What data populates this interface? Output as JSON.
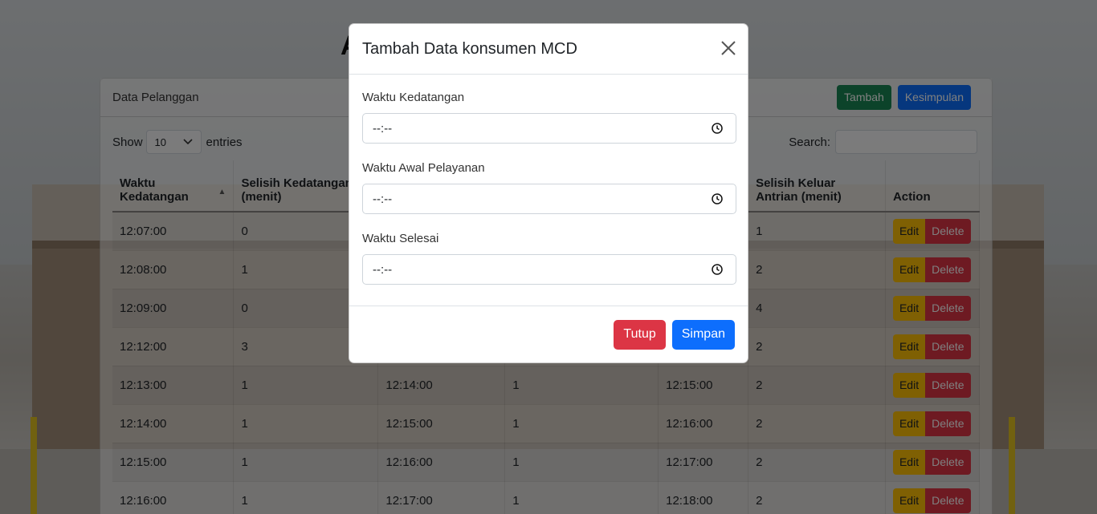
{
  "page": {
    "title_fragment": "A"
  },
  "card": {
    "title": "Data Pelanggan",
    "buttons": {
      "add": "Tambah",
      "summary": "Kesimpulan"
    },
    "show_label": "Show",
    "entries_value": "10",
    "entries_label": "entries",
    "search_label": "Search:"
  },
  "table": {
    "headers": [
      "Waktu Kedatangan",
      "Selisih Kedatangan (menit)",
      "",
      "",
      "",
      "Selisih Keluar Antrian (menit)",
      "Action"
    ],
    "rows": [
      [
        "12:07:00",
        "0",
        "",
        "",
        "",
        "1"
      ],
      [
        "12:08:00",
        "1",
        "",
        "",
        "",
        "2"
      ],
      [
        "12:09:00",
        "0",
        "",
        "",
        "",
        "4"
      ],
      [
        "12:12:00",
        "3",
        "",
        "",
        "",
        "2"
      ],
      [
        "12:13:00",
        "1",
        "12:14:00",
        "1",
        "12:15:00",
        "2"
      ],
      [
        "12:14:00",
        "1",
        "12:15:00",
        "1",
        "12:16:00",
        "2"
      ],
      [
        "12:15:00",
        "1",
        "12:16:00",
        "1",
        "12:17:00",
        "2"
      ],
      [
        "12:16:00",
        "1",
        "12:17:00",
        "1",
        "12:18:00",
        "2"
      ]
    ],
    "edit_label": "Edit",
    "delete_label": "Delete"
  },
  "modal": {
    "title": "Tambah Data konsumen MCD",
    "fields": [
      {
        "label": "Waktu Kedatangan",
        "value": "--:--"
      },
      {
        "label": "Waktu Awal Pelayanan",
        "value": "--:--"
      },
      {
        "label": "Waktu Selesai",
        "value": "--:--"
      }
    ],
    "close_label": "Tutup",
    "save_label": "Simpan"
  },
  "colors": {
    "success": "#198754",
    "primary": "#0d6efd",
    "warning": "#ffc107",
    "danger": "#dc3545"
  }
}
